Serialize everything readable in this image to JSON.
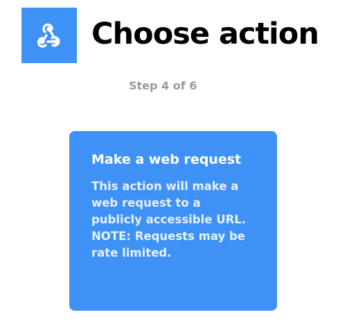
{
  "header": {
    "service_icon": "webhooks-icon",
    "title": "Choose action",
    "step": "Step 4 of 6"
  },
  "action_card": {
    "title": "Make a web request",
    "description": "This action will make a web request to a publicly accessible URL. NOTE: Requests may be rate limited."
  },
  "colors": {
    "accent": "#3e92f5",
    "title_text": "#000000",
    "step_text": "#999999",
    "card_text": "#ffffff"
  }
}
